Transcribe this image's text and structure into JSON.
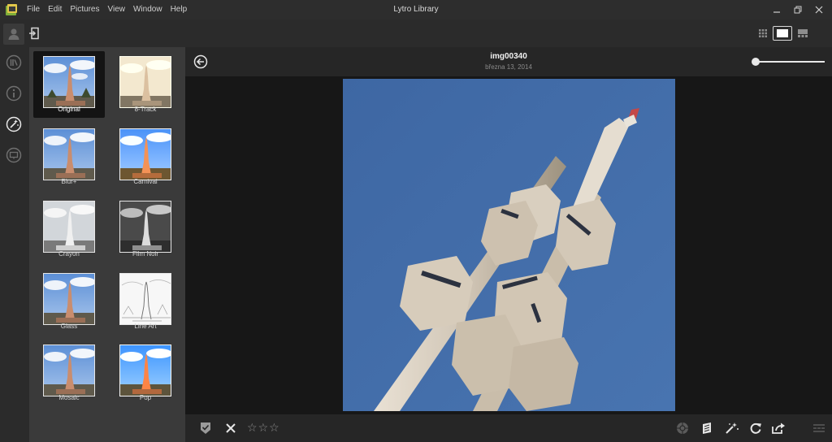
{
  "window": {
    "title": "Lytro Library",
    "menu": [
      "File",
      "Edit",
      "Pictures",
      "View",
      "Window",
      "Help"
    ]
  },
  "header": {
    "image_name": "img00340",
    "image_date": "března 13, 2014"
  },
  "filters": [
    {
      "label": "Original",
      "selected": true
    },
    {
      "label": "8-Track",
      "selected": false
    },
    {
      "label": "Blur+",
      "selected": false
    },
    {
      "label": "Carnival",
      "selected": false
    },
    {
      "label": "Crayon",
      "selected": false
    },
    {
      "label": "Film Noir",
      "selected": false
    },
    {
      "label": "Glass",
      "selected": false
    },
    {
      "label": "Line Art",
      "selected": false
    },
    {
      "label": "Mosaic",
      "selected": false
    },
    {
      "label": "Pop",
      "selected": false
    }
  ],
  "zoom": {
    "level": 0
  },
  "rating": {
    "stars": 0,
    "max": 3
  },
  "icons": {
    "rail": [
      "library-icon",
      "info-icon",
      "effects-icon",
      "slideshow-icon"
    ],
    "bottombar": [
      "flag-icon",
      "reject-icon",
      "focus-icon",
      "perspective-icon",
      "effects-icon",
      "rotate-icon",
      "share-icon",
      "filmstrip-icon"
    ]
  },
  "colors": {
    "panel_bg": "#3a3a3a",
    "sky": "#3f6ba8",
    "tower": "#d8cfc2"
  }
}
